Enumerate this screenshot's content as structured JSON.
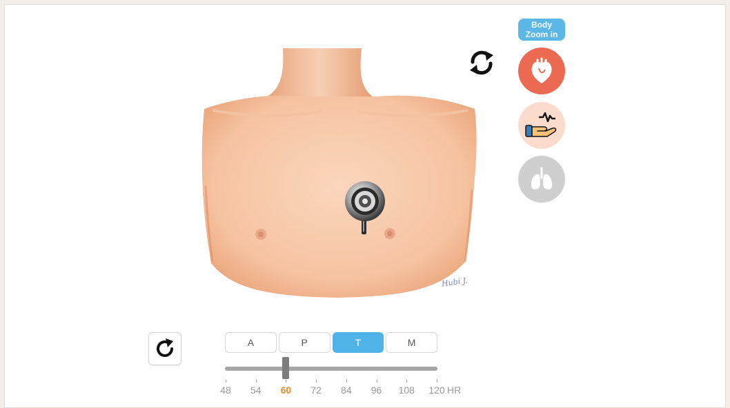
{
  "header": {
    "zoom_line1": "Body",
    "zoom_line2": "Zoom in"
  },
  "figure": {
    "signature": "Hubi J."
  },
  "side_buttons": [
    {
      "name": "heart",
      "icon": "heart-icon",
      "color": "#ec6a52"
    },
    {
      "name": "pulse",
      "icon": "hand-pulse-icon",
      "color": "#fbdccc"
    },
    {
      "name": "lungs",
      "icon": "lungs-icon",
      "color": "#cfcfcf"
    }
  ],
  "tabs": [
    {
      "label": "A",
      "active": false
    },
    {
      "label": "P",
      "active": false
    },
    {
      "label": "T",
      "active": true
    },
    {
      "label": "M",
      "active": false
    }
  ],
  "heart_rate": {
    "ticks": [
      "48",
      "54",
      "60",
      "72",
      "84",
      "96",
      "108",
      "120"
    ],
    "selected": "60",
    "unit": "HR"
  },
  "colors": {
    "accent_blue": "#4fb3e8",
    "selected_orange": "#e98a2e",
    "heart_red": "#ec6a52"
  }
}
